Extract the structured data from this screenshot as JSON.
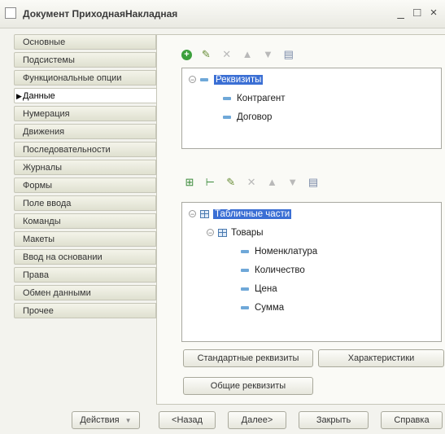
{
  "window": {
    "title": "Документ ПриходнаяНакладная",
    "controls": [
      "_",
      "□",
      "×"
    ]
  },
  "sidebar": {
    "items": [
      {
        "label": "Основные"
      },
      {
        "label": "Подсистемы"
      },
      {
        "label": "Функциональные опции"
      },
      {
        "label": "Данные",
        "active": true
      },
      {
        "label": "Нумерация"
      },
      {
        "label": "Движения"
      },
      {
        "label": "Последовательности"
      },
      {
        "label": "Журналы"
      },
      {
        "label": "Формы"
      },
      {
        "label": "Поле ввода"
      },
      {
        "label": "Команды"
      },
      {
        "label": "Макеты"
      },
      {
        "label": "Ввод на основании"
      },
      {
        "label": "Права"
      },
      {
        "label": "Обмен данными"
      },
      {
        "label": "Прочее"
      }
    ]
  },
  "attributes_tree": {
    "root": "Реквизиты",
    "children": [
      "Контрагент",
      "Договор"
    ]
  },
  "tabular_tree": {
    "root": "Табличные части",
    "table": "Товары",
    "columns": [
      "Номенклатура",
      "Количество",
      "Цена",
      "Сумма"
    ]
  },
  "panel_buttons": {
    "standard_attributes": "Стандартные реквизиты",
    "characteristics": "Характеристики",
    "common_attributes": "Общие реквизиты"
  },
  "footer": {
    "actions": "Действия",
    "back": "<Назад",
    "next": "Далее>",
    "close": "Закрыть",
    "help": "Справка"
  }
}
